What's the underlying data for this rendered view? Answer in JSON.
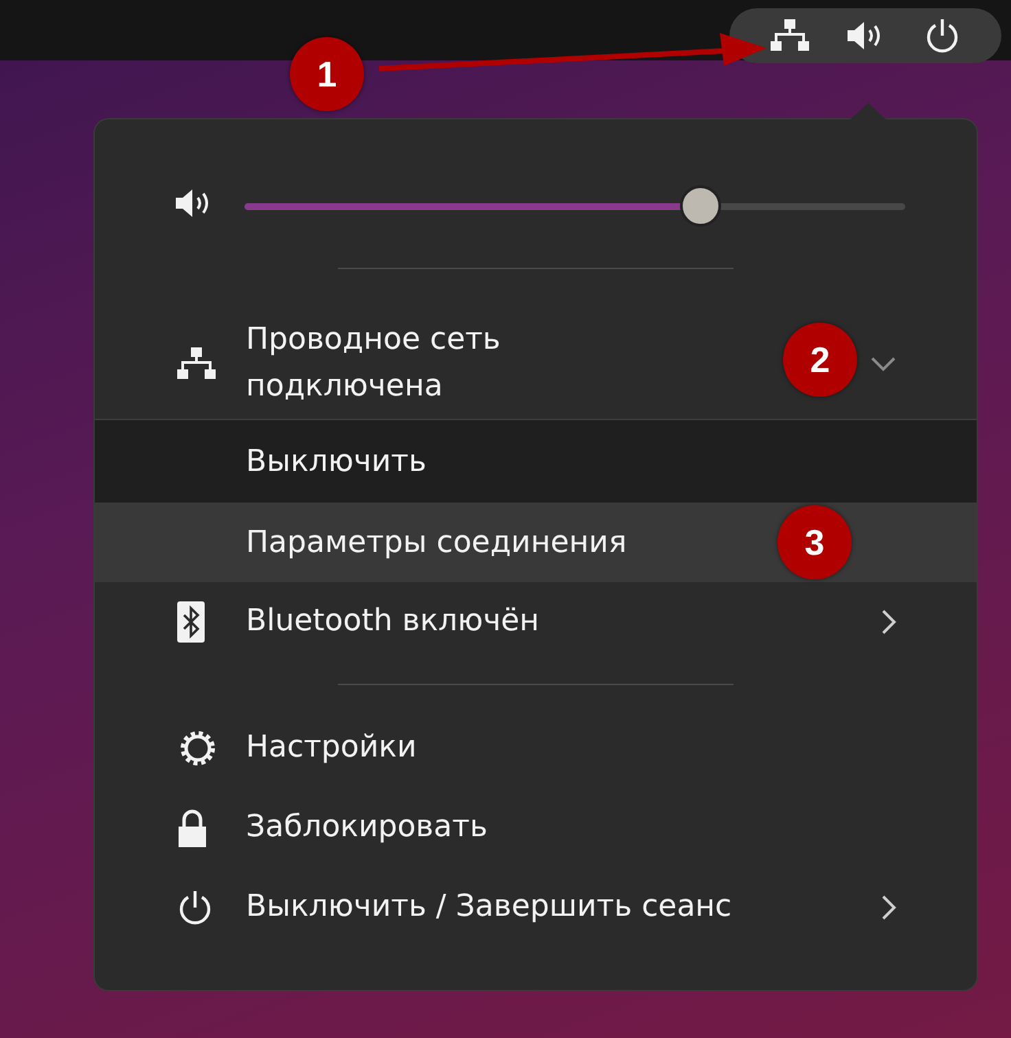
{
  "top_bar": {
    "indicators": [
      {
        "kind": "network"
      },
      {
        "kind": "volume"
      },
      {
        "kind": "power"
      }
    ]
  },
  "menu": {
    "volume_slider": {
      "level": 0.69
    },
    "items": [
      {
        "kind": "network",
        "label": "Проводное сеть подключена",
        "expanded": true,
        "actions": [
          {
            "label": "Выключить",
            "selected": false
          },
          {
            "label": "Параметры соединения",
            "selected": true
          }
        ]
      },
      {
        "kind": "bluetooth",
        "label": "Bluetooth включён",
        "has_submenu": true
      }
    ],
    "system_items": [
      {
        "kind": "settings",
        "label": "Настройки",
        "has_submenu": false
      },
      {
        "kind": "lock",
        "label": "Заблокировать",
        "has_submenu": false
      },
      {
        "kind": "power",
        "label": "Выключить / Завершить сеанс",
        "has_submenu": true
      }
    ]
  },
  "annotations": [
    {
      "label": "1"
    },
    {
      "label": "2"
    },
    {
      "label": "3"
    }
  ]
}
